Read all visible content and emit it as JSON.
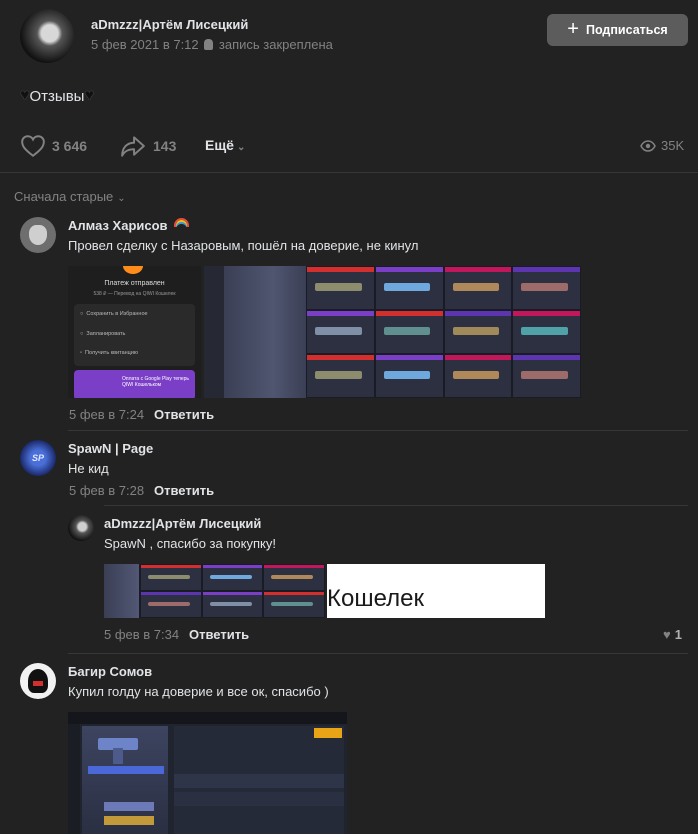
{
  "post": {
    "author": "aDmzzz|Артём Лисецкий",
    "date": "5 фев 2021 в 7:12",
    "pinned": "запись закреплена",
    "subscribe_label": "Подписаться",
    "text": "Отзывы",
    "likes": "3 646",
    "shares": "143",
    "more_label": "Ещё",
    "views": "35K"
  },
  "comments_sort": "Сначала старые",
  "comments": [
    {
      "author": "Алмаз Харисов",
      "text": "Провел сделку с Назаровым, пошёл на доверие, не кинул",
      "date": "5 фев в 7:24",
      "reply_label": "Ответить",
      "attachment_text": {
        "title": "Платеж отправлен",
        "subtitle": "538 ₽ — Перевод на QIWI Кошелек",
        "menu": [
          "Сохранить в Избранное",
          "Запланировать",
          "Получить квитанцию"
        ],
        "promo": "Оплата с Google Play теперь QIWI Кошельком"
      }
    },
    {
      "author": "SpawN | Page",
      "text": "Не кид",
      "date": "5 фев в 7:28",
      "reply_label": "Ответить"
    },
    {
      "author": "aDmzzz|Артём Лисецкий",
      "text": "SpawN , спасибо за покупку!",
      "date": "5 фев в 7:34",
      "reply_label": "Ответить",
      "likes": "1",
      "attachment_text": "Кошелек"
    },
    {
      "author": "Багир Сомов",
      "text": "Купил голду на доверие и все ок, спасибо )"
    }
  ],
  "colors": {
    "background": "#222222",
    "text": "#e1e3e6",
    "muted": "#828282",
    "button": "#5c5c5c"
  }
}
